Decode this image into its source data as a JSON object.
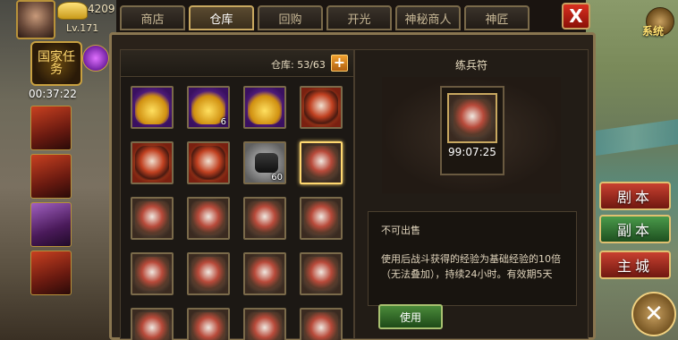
{
  "player": {
    "gold": "4209",
    "level": "Lv.171",
    "quest_badge": "国家任务",
    "timer": "00:37:22"
  },
  "tabs": [
    {
      "label": "商店"
    },
    {
      "label": "仓库"
    },
    {
      "label": "回购"
    },
    {
      "label": "开光"
    },
    {
      "label": "神秘商人"
    },
    {
      "label": "神匠"
    }
  ],
  "active_tab": "仓库",
  "close_label": "X",
  "settings_label": "系统",
  "inventory": {
    "capacity": "仓库: 53/63",
    "expand_label": "+",
    "slots": [
      {
        "name": "gold-bag",
        "bg": "purple",
        "art": "gold-pile",
        "count": ""
      },
      {
        "name": "gold-bag",
        "bg": "purple",
        "art": "gold-pile",
        "count": "6"
      },
      {
        "name": "gold-ingots",
        "bg": "purple",
        "art": "gold-pile",
        "count": ""
      },
      {
        "name": "relic",
        "bg": "orange",
        "art": "relic",
        "count": ""
      },
      {
        "name": "relic",
        "bg": "orange",
        "art": "relic",
        "count": ""
      },
      {
        "name": "relic",
        "bg": "orange",
        "art": "relic",
        "count": ""
      },
      {
        "name": "coal",
        "bg": "gray",
        "art": "coal",
        "count": "60"
      },
      {
        "name": "training-charm",
        "bg": "dark",
        "art": "charm",
        "count": "",
        "selected": true
      },
      {
        "name": "training-charm",
        "bg": "dark",
        "art": "charm",
        "count": ""
      },
      {
        "name": "training-charm",
        "bg": "dark",
        "art": "charm",
        "count": ""
      },
      {
        "name": "training-charm",
        "bg": "dark",
        "art": "charm",
        "count": ""
      },
      {
        "name": "training-charm",
        "bg": "dark",
        "art": "charm",
        "count": ""
      },
      {
        "name": "training-charm",
        "bg": "dark",
        "art": "charm",
        "count": ""
      },
      {
        "name": "training-charm",
        "bg": "dark",
        "art": "charm",
        "count": ""
      },
      {
        "name": "training-charm",
        "bg": "dark",
        "art": "charm",
        "count": ""
      },
      {
        "name": "training-charm",
        "bg": "dark",
        "art": "charm",
        "count": ""
      },
      {
        "name": "training-charm",
        "bg": "dark",
        "art": "charm",
        "count": ""
      },
      {
        "name": "training-charm",
        "bg": "dark",
        "art": "charm",
        "count": ""
      },
      {
        "name": "training-charm",
        "bg": "dark",
        "art": "charm",
        "count": ""
      },
      {
        "name": "training-charm",
        "bg": "dark",
        "art": "charm",
        "count": ""
      }
    ]
  },
  "detail": {
    "title": "练兵符",
    "timer": "99:07:25",
    "not_for_sale": "不可出售",
    "description": "使用后战斗获得的经验为基础经验的10倍（无法叠加），持续24小时。有效期5天",
    "use_label": "使用"
  },
  "side_buttons": [
    {
      "label": "剧本",
      "style": "red"
    },
    {
      "label": "副本",
      "style": "green"
    },
    {
      "label": "主城",
      "style": "red"
    }
  ],
  "corner_close_label": "✕",
  "colors": {
    "frame_gold": "#8a7650",
    "active_tab": "#c8a860",
    "close_red": "#d83020",
    "use_green": "#4a8a3a"
  }
}
